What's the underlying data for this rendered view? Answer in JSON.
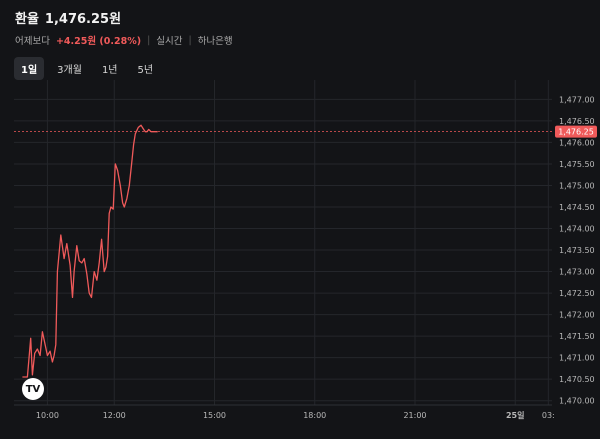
{
  "header": {
    "title": "환율",
    "price": "1,476.25원",
    "change_label": "어제보다",
    "change_value": "+4.25원 (0.28%)",
    "realtime": "실시간",
    "source": "하나은행"
  },
  "tabs": [
    {
      "label": "1일",
      "active": true
    },
    {
      "label": "3개월",
      "active": false
    },
    {
      "label": "1년",
      "active": false
    },
    {
      "label": "5년",
      "active": false
    }
  ],
  "colors": {
    "line": "#f05a5a",
    "background": "#131417",
    "grid": "#24262b",
    "price_tag_bg": "#f05a5a"
  },
  "logo": {
    "text": "TV"
  },
  "chart_data": {
    "type": "line",
    "y_axis": {
      "ylim": [
        1469.9,
        1477.45
      ],
      "ticks": [
        1470.0,
        1470.5,
        1471.0,
        1471.5,
        1472.0,
        1472.5,
        1473.0,
        1473.5,
        1474.0,
        1474.5,
        1475.0,
        1475.5,
        1476.0,
        1476.5,
        1477.0
      ],
      "tick_labels": [
        "1,470.00",
        "1,470.50",
        "1,471.00",
        "1,471.50",
        "1,472.00",
        "1,472.50",
        "1,473.00",
        "1,473.50",
        "1,474.00",
        "1,474.50",
        "1,475.00",
        "1,475.50",
        "1,476.00",
        "1,476.50",
        "1,477.00"
      ]
    },
    "x_axis": {
      "xlim": [
        9.0,
        25.1
      ],
      "ticks": [
        10.0,
        12.0,
        15.0,
        18.0,
        21.0,
        24.0,
        24.99
      ],
      "tick_labels": [
        "10:00",
        "12:00",
        "15:00",
        "18:00",
        "21:00",
        "25일",
        "03:"
      ],
      "bold": [
        false,
        false,
        false,
        false,
        false,
        true,
        false
      ]
    },
    "last_price": {
      "value": 1476.25,
      "label": "1,476.25"
    },
    "series": [
      {
        "x": [
          9.25,
          9.4,
          9.5,
          9.55,
          9.62,
          9.7,
          9.78,
          9.85,
          9.92,
          10.0,
          10.08,
          10.15,
          10.2,
          10.25,
          10.3,
          10.4,
          10.5,
          10.58,
          10.68,
          10.75,
          10.8,
          10.88,
          10.95,
          11.03,
          11.1,
          11.18,
          11.25,
          11.32,
          11.4,
          11.48,
          11.55,
          11.62,
          11.7,
          11.75,
          11.8,
          11.85,
          11.9,
          11.97,
          12.03,
          12.1,
          12.18,
          12.25,
          12.3,
          12.38,
          12.45,
          12.52,
          12.58,
          12.63,
          12.72,
          12.8,
          12.88,
          12.93,
          12.98,
          13.03,
          13.1,
          13.15,
          13.2,
          13.25,
          13.3
        ],
        "y": [
          1470.55,
          1470.55,
          1471.45,
          1470.6,
          1471.1,
          1471.2,
          1471.05,
          1471.6,
          1471.35,
          1471.05,
          1471.15,
          1470.9,
          1471.05,
          1471.3,
          1473.0,
          1473.85,
          1473.3,
          1473.65,
          1473.15,
          1472.4,
          1473.0,
          1473.6,
          1473.25,
          1473.2,
          1473.3,
          1472.95,
          1472.5,
          1472.4,
          1473.0,
          1472.8,
          1473.2,
          1473.75,
          1473.0,
          1473.1,
          1473.35,
          1474.35,
          1474.5,
          1474.45,
          1475.5,
          1475.35,
          1475.0,
          1474.6,
          1474.5,
          1474.7,
          1475.0,
          1475.5,
          1475.95,
          1476.2,
          1476.35,
          1476.4,
          1476.3,
          1476.25,
          1476.25,
          1476.3,
          1476.25,
          1476.25,
          1476.25,
          1476.25,
          1476.25
        ]
      }
    ]
  }
}
